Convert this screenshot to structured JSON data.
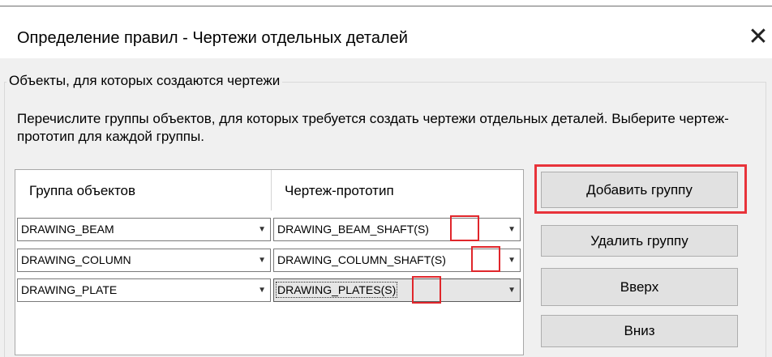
{
  "window": {
    "title": "Определение правил - Чертежи отдельных деталей",
    "close_glyph": "✕"
  },
  "groupbox": {
    "legend": "Объекты, для которых создаются чертежи",
    "description": "Перечислите группы объектов, для которых требуется создать чертежи отдельных деталей. Выберите чертеж-прототип для каждой группы."
  },
  "grid": {
    "columns": [
      "Группа объектов",
      "Чертеж-прототип"
    ],
    "rows": [
      {
        "group": "DRAWING_BEAM",
        "prototype": "DRAWING_BEAM_SHAFT(S)"
      },
      {
        "group": "DRAWING_COLUMN",
        "prototype": "DRAWING_COLUMN_SHAFT(S)"
      },
      {
        "group": "DRAWING_PLATE",
        "prototype": "DRAWING_PLATES(S)"
      }
    ],
    "dropdown_glyph": "▼"
  },
  "buttons": {
    "add": "Добавить группу",
    "delete": "Удалить группу",
    "up": "Вверх",
    "down": "Вниз"
  },
  "colors": {
    "highlight_red": "#e0262b",
    "window_bg": "#f0f0f0",
    "button_bg": "#e1e1e1"
  }
}
